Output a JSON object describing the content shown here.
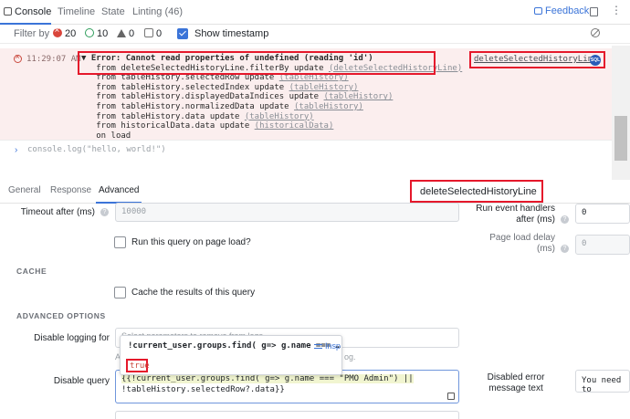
{
  "tabs": [
    {
      "label": "Console"
    },
    {
      "label": "Timeline"
    },
    {
      "label": "State"
    },
    {
      "label": "Linting (46)"
    }
  ],
  "feedback_label": "Feedback",
  "filters": {
    "label": "Filter by",
    "errors": "20",
    "info": "10",
    "warnings": "0",
    "logs": "0",
    "timestamp_label": "Show timestamp"
  },
  "error_entry": {
    "time": "11:29:07 AM",
    "source": "deleteSelectedHistoryLine",
    "badge": "SQL",
    "title": "▼ Error: Cannot read properties of undefined (reading 'id')",
    "stack": [
      {
        "text": "from deleteSelectedHistoryLine.filterBy update",
        "link": "(deleteSelectedHistoryLine)"
      },
      {
        "text": "from tableHistory.selectedRow update",
        "link": "(tableHistory)"
      },
      {
        "text": "from tableHistory.selectedIndex update",
        "link": "(tableHistory)"
      },
      {
        "text": "from tableHistory.displayedDataIndices update",
        "link": "(tableHistory)"
      },
      {
        "text": "from tableHistory.normalizedData update",
        "link": "(tableHistory)"
      },
      {
        "text": "from tableHistory.data update",
        "link": "(tableHistory)"
      },
      {
        "text": "from historicalData.data update",
        "link": "(historicalData)"
      },
      {
        "text": "on load",
        "link": ""
      }
    ]
  },
  "console_input": "console.log(\"hello, world!\")",
  "panel_tabs": [
    {
      "label": "General"
    },
    {
      "label": "Response"
    },
    {
      "label": "Advanced"
    }
  ],
  "query_name": "deleteSelectedHistoryLine",
  "form": {
    "timeout_label": "Timeout after (ms)",
    "timeout_value": "10000",
    "run_event_handlers_label": "Run event handlers after (ms)",
    "run_event_handlers_value": "0",
    "run_on_load_label": "Run this query on page load?",
    "page_load_delay_label": "Page load delay (ms)",
    "page_load_delay_value": "0",
    "cache_section": "CACHE",
    "cache_label": "Cache the results of this query",
    "advanced_section": "ADVANCED OPTIONS",
    "disable_logging_label": "Disable logging for",
    "disable_logging_behind": "Select parameters to remove from logs",
    "disable_logging_behind2": "A",
    "disable_logging_behind3": "og.",
    "disable_query_label": "Disable query",
    "disable_query_line1": "{{!current_user.groups.find( g=> g.name === \"PMO Admin\") ||",
    "disable_query_line2": "!tableHistory.selectedRow?.data}}",
    "disabled_error_label": "Disabled error message text",
    "disabled_error_value": "You need to"
  },
  "popup": {
    "expression": "!current_user.groups.find( g=> g.name === …",
    "inspect_label": "Insp",
    "result": "true"
  },
  "colors": {
    "accent": "#3b74d8",
    "error": "#d9453b",
    "error_bg": "#fbeeee",
    "annotation_red": "#e5182b"
  }
}
